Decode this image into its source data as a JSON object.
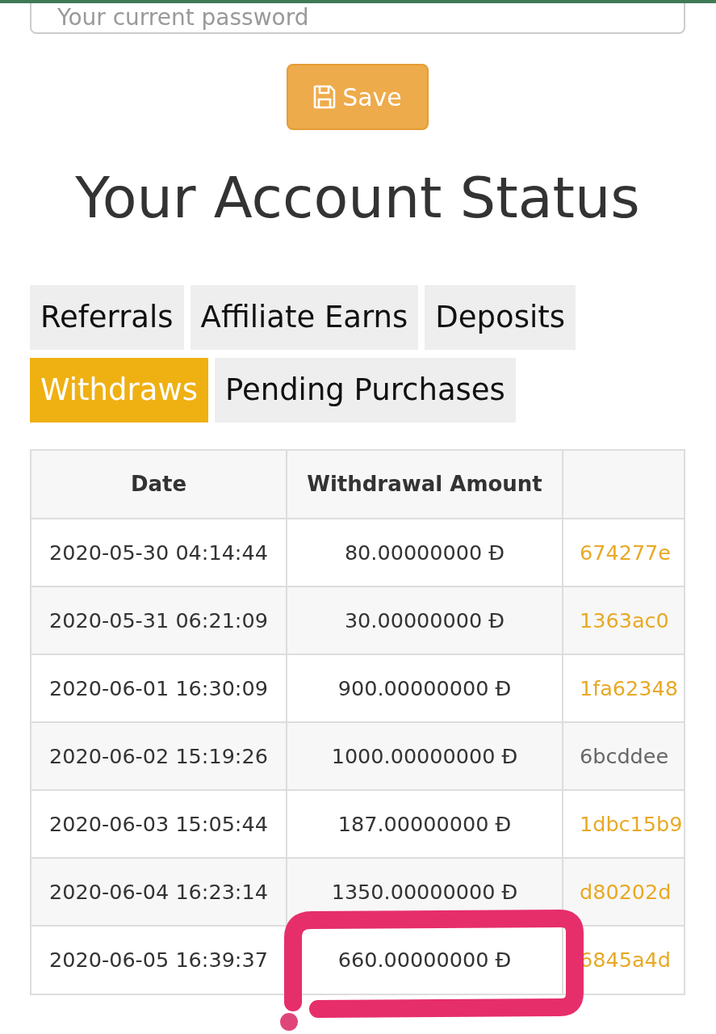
{
  "password_field": {
    "placeholder": "Your current password"
  },
  "save_button": {
    "label": "Save"
  },
  "heading": "Your Account Status",
  "tabs": [
    {
      "label": "Referrals",
      "selected": false
    },
    {
      "label": "Affiliate Earns",
      "selected": false
    },
    {
      "label": "Deposits",
      "selected": false
    },
    {
      "label": "Withdraws",
      "selected": true
    },
    {
      "label": "Pending Purchases",
      "selected": false
    }
  ],
  "table": {
    "columns": [
      "Date",
      "Withdrawal Amount"
    ],
    "rows": [
      {
        "date": "2020-05-30 04:14:44",
        "withdrawal_amount": "80.00000000 Đ",
        "column_3": "674277e",
        "linked": true,
        "marked": false
      },
      {
        "date": "2020-05-31 06:21:09",
        "withdrawal_amount": "30.00000000 Đ",
        "column_3": "1363ac0",
        "linked": true,
        "marked": false
      },
      {
        "date": "2020-06-01 16:30:09",
        "withdrawal_amount": "900.00000000 Đ",
        "column_3": "1fa62348",
        "linked": true,
        "marked": false
      },
      {
        "date": "2020-06-02 15:19:26",
        "withdrawal_amount": "1000.00000000 Đ",
        "column_3": "6bcddee",
        "linked": false,
        "marked": false
      },
      {
        "date": "2020-06-03 15:05:44",
        "withdrawal_amount": "187.00000000 Đ",
        "column_3": "1dbc15b9",
        "linked": true,
        "marked": false
      },
      {
        "date": "2020-06-04 16:23:14",
        "withdrawal_amount": "1350.00000000 Đ",
        "column_3": "d80202d",
        "linked": true,
        "marked": false
      },
      {
        "date": "2020-06-05 16:39:37",
        "withdrawal_amount": "660.00000000 Đ",
        "column_3": "6845a4d",
        "linked": true,
        "marked": true
      }
    ]
  }
}
